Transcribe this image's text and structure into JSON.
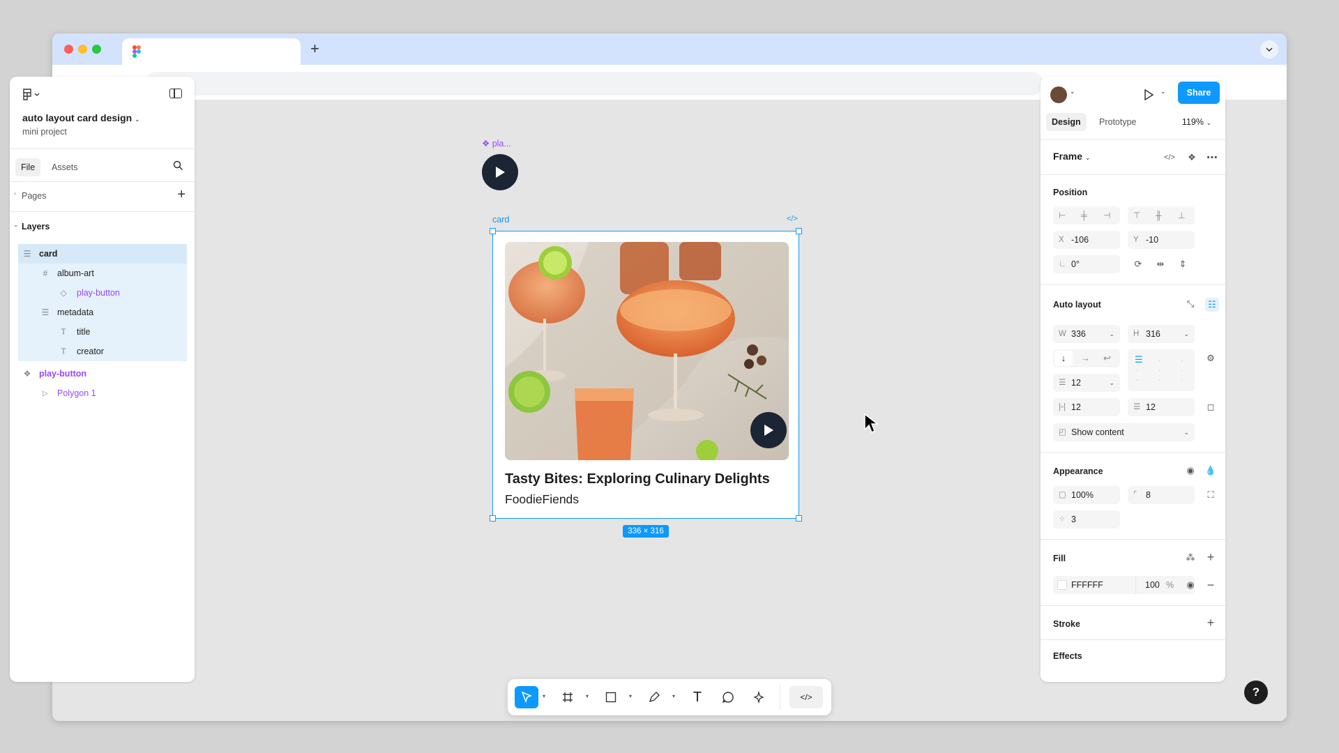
{
  "browser": {
    "tab_icon": "figma-logo-icon",
    "new_tab_label": "+",
    "address_value": ""
  },
  "left_panel": {
    "project_title": "auto layout card design",
    "project_subtitle": "mini project",
    "tabs": [
      {
        "label": "File"
      },
      {
        "label": "Assets"
      }
    ],
    "pages_label": "Pages",
    "layers_label": "Layers",
    "layers": [
      {
        "name": "card",
        "icon": "auto-layout-icon"
      },
      {
        "name": "album-art",
        "icon": "frame-icon"
      },
      {
        "name": "play-button",
        "icon": "instance-icon"
      },
      {
        "name": "metadata",
        "icon": "auto-layout-icon"
      },
      {
        "name": "title",
        "icon": "text-icon"
      },
      {
        "name": "creator",
        "icon": "text-icon"
      },
      {
        "name": "play-button",
        "icon": "component-icon"
      },
      {
        "name": "Polygon 1",
        "icon": "polygon-icon"
      }
    ]
  },
  "canvas": {
    "play_button_label": "pla...",
    "card_label": "card",
    "card_code_icon": "code-icon",
    "card_title": "Tasty Bites: Exploring Culinary Delights",
    "card_creator": "FoodieFiends",
    "dimension_badge": "336 × 316"
  },
  "right_panel": {
    "share_label": "Share",
    "tabs": [
      {
        "label": "Design"
      },
      {
        "label": "Prototype"
      }
    ],
    "zoom": "119%",
    "frame_label": "Frame",
    "position_label": "Position",
    "x_label": "X",
    "x": "-106",
    "y_label": "Y",
    "y": "-10",
    "rotation": "0°",
    "auto_layout_label": "Auto layout",
    "w_label": "W",
    "w": "336",
    "h_label": "H",
    "h": "316",
    "gap": "12",
    "padding_h": "12",
    "padding_v": "12",
    "clip_label": "Show content",
    "appearance_label": "Appearance",
    "opacity": "100%",
    "radius": "8",
    "radius_extra": "3",
    "fill_label": "Fill",
    "fill_hex": "FFFFFF",
    "fill_opacity": "100",
    "fill_percent": "%",
    "stroke_label": "Stroke",
    "effects_label": "Effects",
    "help_label": "?"
  },
  "colors": {
    "accent": "#0d99ff",
    "component": "#9747ff",
    "tabbar": "#d3e3fd",
    "canvas": "#e5e5e5",
    "dark_button": "#1b2533"
  }
}
